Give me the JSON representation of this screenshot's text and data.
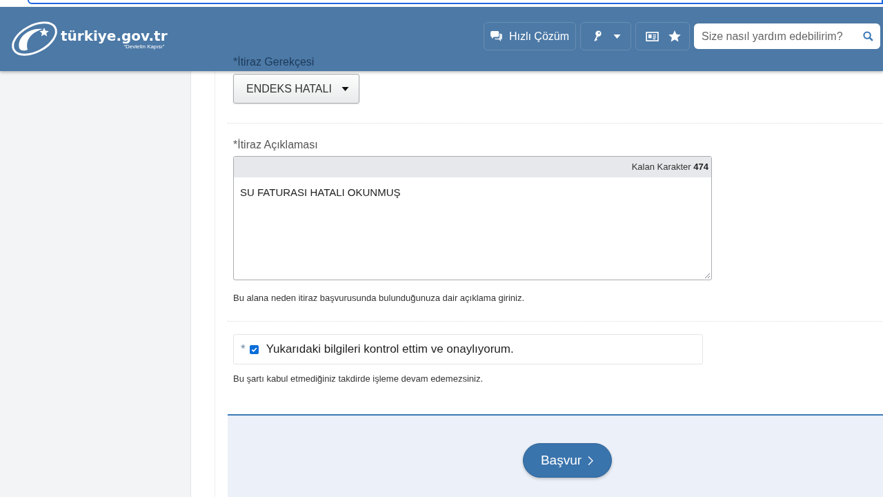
{
  "header": {
    "logo": {
      "wordmark": "türkiye.gov.tr",
      "tagline": "“Devletin Kapısı”"
    },
    "quick_solution_button": "Hızlı Çözüm",
    "search": {
      "placeholder": "Size nasıl yardım edebilirim?"
    }
  },
  "form": {
    "reason": {
      "label": "*İtiraz Gerekçesi",
      "value": "ENDEKS HATALI"
    },
    "description": {
      "label": "*İtiraz Açıklaması",
      "counter": "Kalan Karakter **474**",
      "value": "SU FATURASI HATALI OKUNMUŞ",
      "hint": "Bu alana neden itiraz başvurusunda bulunduğunuza dair açıklama giriniz."
    },
    "confirm": {
      "required_mark": "*",
      "checked": true,
      "label": "Yukarıdaki bilgileri kontrol ettim ve onaylıyorum.",
      "hint": "Bu şartı kabul etmediğiniz takdirde işleme devam edemezsiniz."
    }
  },
  "submit_button": "Başvur"
}
